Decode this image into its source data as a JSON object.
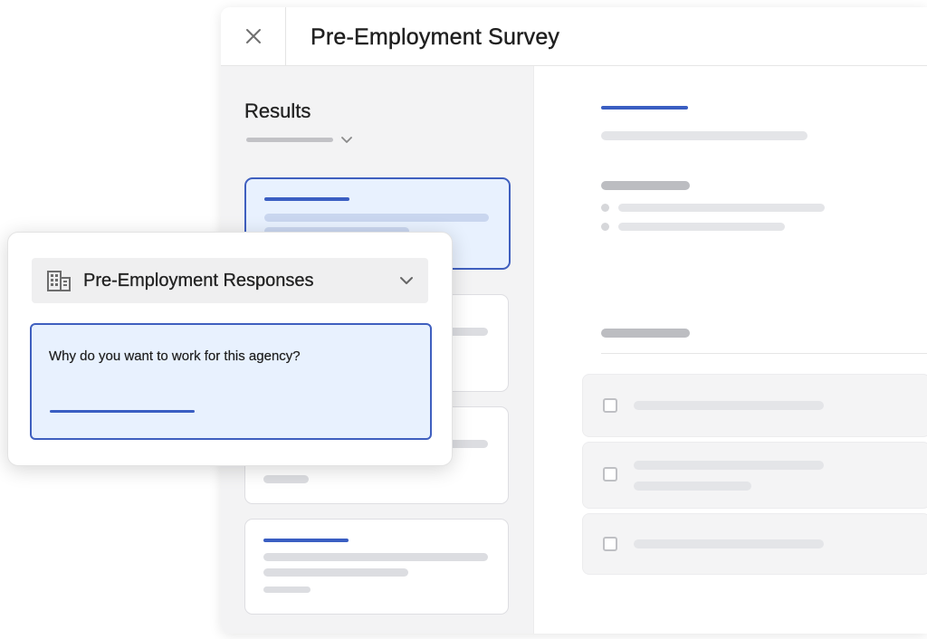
{
  "window": {
    "title": "Pre-Employment Survey",
    "close_icon": "close-icon"
  },
  "sidebar": {
    "title": "Results",
    "filter_icon": "chevron-down-icon"
  },
  "popup": {
    "dropdown_icon": "building-icon",
    "dropdown_label": "Pre-Employment Responses",
    "dropdown_chevron": "chevron-down-icon",
    "question": "Why do you want to work for this agency?"
  },
  "colors": {
    "accent": "#3a5ec2",
    "selected_bg": "#e8f1fe",
    "sidebar_bg": "#f3f3f4"
  }
}
